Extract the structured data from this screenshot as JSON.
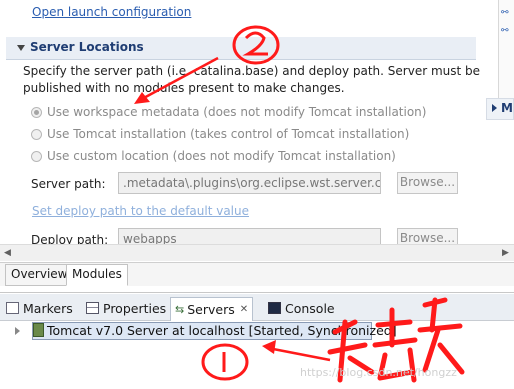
{
  "top_link": "Open launch configuration",
  "section": {
    "title": "Server Locations",
    "description_line1": "Specify the server path (i.e. catalina.base) and deploy path. Server must be",
    "description_line2": "published with no modules present to make changes."
  },
  "radios": [
    {
      "label": "Use workspace metadata (does not modify Tomcat installation)",
      "checked": true
    },
    {
      "label": "Use Tomcat installation (takes control of Tomcat installation)",
      "checked": false
    },
    {
      "label": "Use custom location (does not modify Tomcat installation)",
      "checked": false
    }
  ],
  "server_path": {
    "label": "Server path:",
    "value": ".metadata\\.plugins\\org.eclipse.wst.server.co",
    "browse": "Browse..."
  },
  "default_link": "Set deploy path to the default value",
  "deploy_path": {
    "label": "Deploy path:",
    "value": "webapps",
    "browse": "Browse..."
  },
  "editor_tabs": [
    {
      "label": "Overview",
      "active": false
    },
    {
      "label": "Modules",
      "active": true
    }
  ],
  "view_tabs": {
    "markers": "Markers",
    "properties": "Properties",
    "servers": "Servers",
    "servers_close": "✕",
    "console": "Console"
  },
  "server_entry": "Tomcat v7.0 Server at localhost  [Started, Synchronized]",
  "right_panel_mark": "M",
  "watermark": "https://blog.csdn.net/hongzz",
  "annotations": {
    "circle_2": "②",
    "circle_1": "①",
    "color": "#ff1a1a"
  },
  "colors": {
    "link": "#2a5db0",
    "section_title": "#1f3d73",
    "server_row": "#dde7f5"
  }
}
